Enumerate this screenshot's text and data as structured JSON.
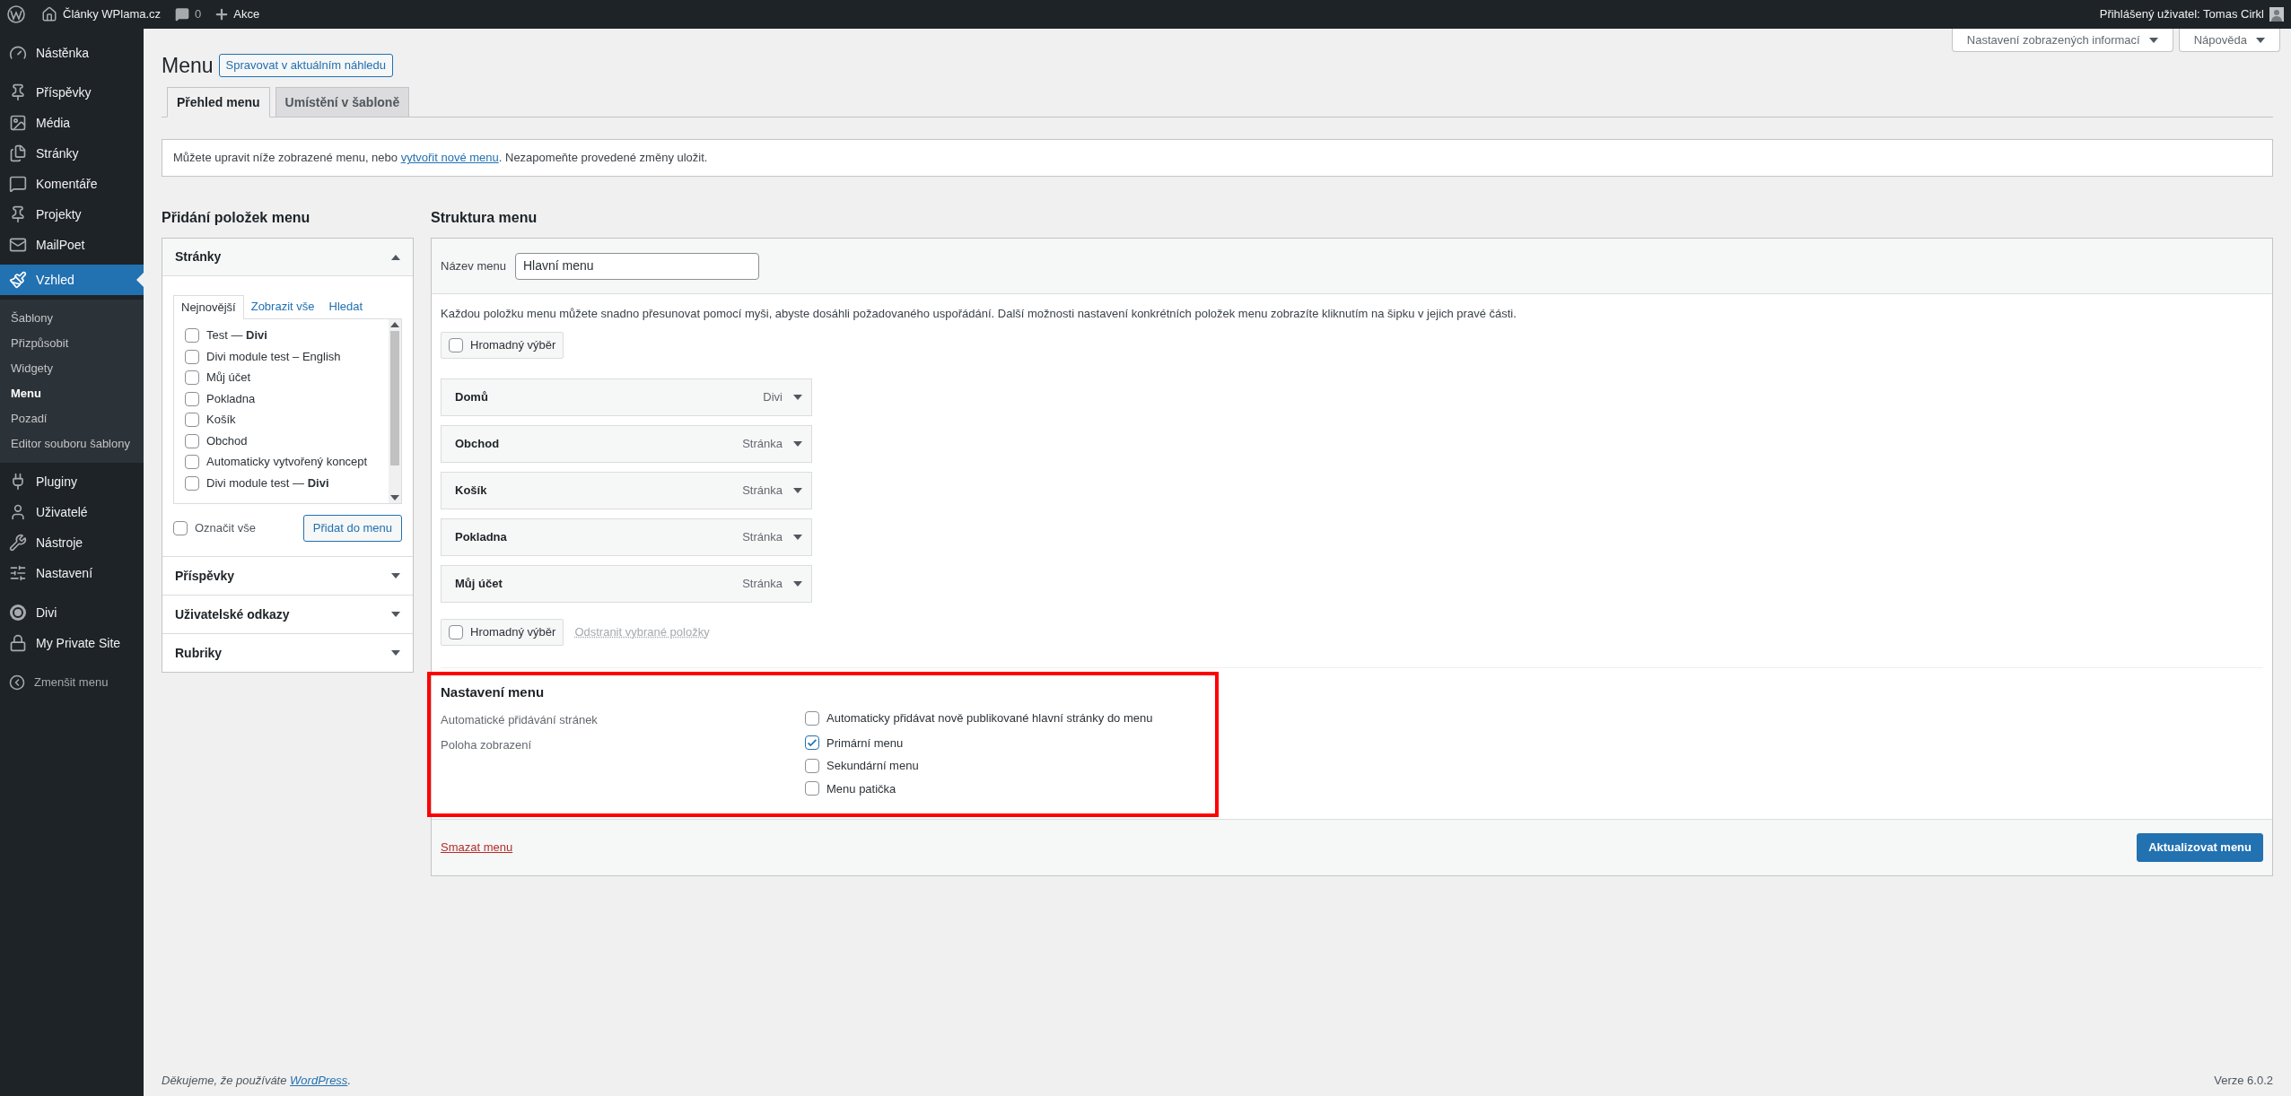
{
  "admin_bar": {
    "site_name": "Články WPlama.cz",
    "comments_count": "0",
    "new_label": "Akce",
    "user_greeting": "Přihlášený uživatel: Tomas Cirkl"
  },
  "sidebar": {
    "groups": [
      {
        "items": [
          {
            "label": "Nástěnka",
            "selected": false
          }
        ]
      },
      {
        "items": [
          {
            "label": "Příspěvky",
            "selected": false
          },
          {
            "label": "Média",
            "selected": false
          },
          {
            "label": "Stránky",
            "selected": false
          },
          {
            "label": "Komentáře",
            "selected": false
          },
          {
            "label": "Projekty",
            "selected": false
          },
          {
            "label": "MailPoet",
            "selected": false
          },
          {
            "label": "Vzhled",
            "selected": true,
            "children": [
              {
                "label": "Šablony",
                "selected": false
              },
              {
                "label": "Přizpůsobit",
                "selected": false
              },
              {
                "label": "Widgety",
                "selected": false
              },
              {
                "label": "Menu",
                "selected": true
              },
              {
                "label": "Pozadí",
                "selected": false
              },
              {
                "label": "Editor souboru šablony",
                "selected": false
              }
            ]
          },
          {
            "label": "Pluginy",
            "selected": false
          },
          {
            "label": "Uživatelé",
            "selected": false
          },
          {
            "label": "Nástroje",
            "selected": false
          },
          {
            "label": "Nastavení",
            "selected": false
          }
        ]
      },
      {
        "items": [
          {
            "label": "Divi",
            "selected": false
          },
          {
            "label": "My Private Site",
            "selected": false
          }
        ]
      }
    ],
    "collapse_label": "Zmenšit menu"
  },
  "screen_options": [
    {
      "label": "Nastavení zobrazených informací"
    },
    {
      "label": "Nápověda"
    }
  ],
  "page": {
    "title": "Menu",
    "action": "Spravovat v aktuálním náhledu",
    "tabs": [
      {
        "label": "Přehled menu",
        "selected": true
      },
      {
        "label": "Umístění v šabloně",
        "selected": false
      }
    ],
    "notice": {
      "before": "Můžete upravit níže zobrazené menu, nebo ",
      "link": "vytvořit nové menu",
      "after": ". Nezapomeňte provedené změny uložit."
    }
  },
  "add_items": {
    "heading": "Přidání položek menu",
    "sections": [
      {
        "title": "Stránky",
        "expanded": true,
        "tabs": [
          {
            "label": "Nejnovější",
            "selected": true
          },
          {
            "label": "Zobrazit vše",
            "selected": false
          },
          {
            "label": "Hledat",
            "selected": false
          }
        ],
        "items": [
          {
            "label": "Test — **Divi**",
            "checked": false
          },
          {
            "label": "Divi module test – English",
            "checked": false
          },
          {
            "label": "Můj účet",
            "checked": false
          },
          {
            "label": "Pokladna",
            "checked": false
          },
          {
            "label": "Košík",
            "checked": false
          },
          {
            "label": "Obchod",
            "checked": false
          },
          {
            "label": "Automaticky vytvořený koncept",
            "checked": false
          },
          {
            "label": "Divi module test — **Divi**",
            "checked": false
          }
        ],
        "select_all": {
          "label": "Označit vše",
          "checked": false
        },
        "add_button": "Přidat do menu"
      },
      {
        "title": "Příspěvky",
        "expanded": false
      },
      {
        "title": "Uživatelské odkazy",
        "expanded": false
      },
      {
        "title": "Rubriky",
        "expanded": false
      }
    ]
  },
  "structure": {
    "heading": "Struktura menu",
    "name_label": "Název menu",
    "name_value": "Hlavní menu",
    "instructions": "Každou položku menu můžete snadno přesunovat pomocí myši, abyste dosáhli požadovaného uspořádání. Další možnosti nastavení konkrétních položek menu zobrazíte kliknutím na šipku v jejich pravé části.",
    "bulk_select": [
      {
        "label": "Hromadný výběr",
        "checked": false
      },
      {
        "label": "Hromadný výběr",
        "checked": false
      }
    ],
    "remove_selected": {
      "label": "Odstranit vybrané položky",
      "disabled": true
    },
    "items": [
      {
        "title": "Domů",
        "type": "Divi"
      },
      {
        "title": "Obchod",
        "type": "Stránka"
      },
      {
        "title": "Košík",
        "type": "Stránka"
      },
      {
        "title": "Pokladna",
        "type": "Stránka"
      },
      {
        "title": "Můj účet",
        "type": "Stránka"
      }
    ],
    "settings": {
      "title": "Nastavení menu",
      "rows": [
        {
          "label": "Automatické přidávání stránek",
          "options": [
            {
              "label": "Automaticky přidávat nově publikované hlavní stránky do menu",
              "checked": false
            }
          ]
        },
        {
          "label": "Poloha zobrazení",
          "options": [
            {
              "label": "Primární menu",
              "checked": true
            },
            {
              "label": "Sekundární menu",
              "checked": false
            },
            {
              "label": "Menu patička",
              "checked": false
            }
          ]
        }
      ]
    },
    "delete_link": "Smazat menu",
    "save_button": "Aktualizovat menu"
  },
  "footer": {
    "thanks_before": "Děkujeme, že používáte ",
    "link": "WordPress",
    "thanks_after": ".",
    "version": "Verze 6.0.2"
  }
}
